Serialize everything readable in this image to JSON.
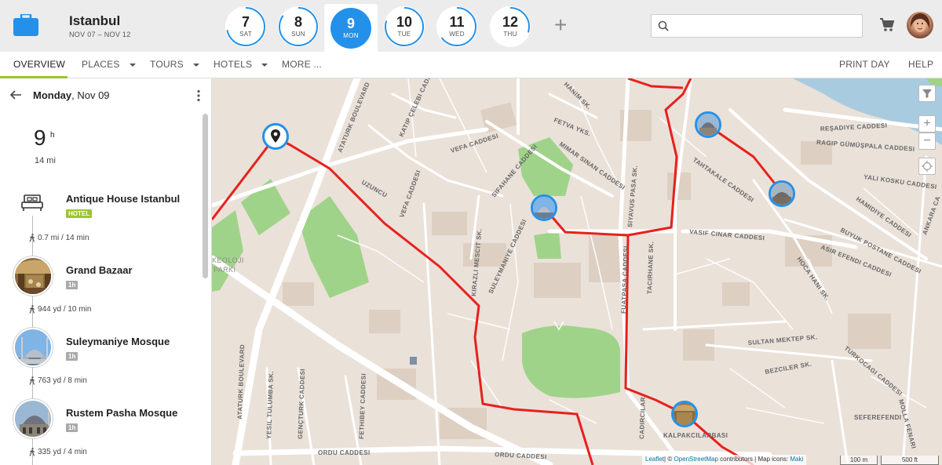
{
  "header": {
    "city": "Istanbul",
    "date_range": "NOV 07 – NOV 12",
    "days": [
      {
        "num": "7",
        "name": "SAT",
        "progress": 0.72
      },
      {
        "num": "8",
        "name": "SUN",
        "progress": 0.85
      },
      {
        "num": "9",
        "name": "MON",
        "progress": 1.0,
        "active": true
      },
      {
        "num": "10",
        "name": "TUE",
        "progress": 0.8
      },
      {
        "num": "11",
        "name": "WED",
        "progress": 0.65
      },
      {
        "num": "12",
        "name": "THU",
        "progress": 0.3
      }
    ],
    "add_day": "+",
    "search_placeholder": "",
    "accent": "#2391ea"
  },
  "tabs": {
    "overview": "OVERVIEW",
    "places": "PLACES",
    "tours": "TOURS",
    "hotels": "HOTELS",
    "more": "MORE",
    "more_dots": "...",
    "print_day": "PRINT DAY",
    "help": "HELP",
    "active_color": "#9bc531"
  },
  "sidebar": {
    "weekday": "Monday",
    "date": ", Nov 09",
    "hours_value": "9",
    "hours_unit": "h",
    "distance": "14 mi",
    "stops": [
      {
        "name": "Antique House Istanbul",
        "badge": "HOTEL",
        "badge_color": "#9bc531",
        "icon": "bed-icon"
      },
      {
        "name": "Grand Bazaar",
        "badge": "1h",
        "badge_color": "#aaaaaa"
      },
      {
        "name": "Suleymaniye Mosque",
        "badge": "1h",
        "badge_color": "#aaaaaa"
      },
      {
        "name": "Rustem Pasha Mosque",
        "badge": "1h",
        "badge_color": "#aaaaaa"
      }
    ],
    "legs": [
      {
        "dist": "0.7 mi",
        "time": "14 min"
      },
      {
        "dist": "944 yd",
        "time": "10 min"
      },
      {
        "dist": "763 yd",
        "time": "8 min"
      },
      {
        "dist": "335 yd",
        "time": "4 min"
      }
    ],
    "leg_separator": "/"
  },
  "map": {
    "route_color": "#e8201c",
    "streets": {
      "ataturk_blvd_top": "ATATURK BOULEVARD",
      "ataturk_blvd_bottom": "ATATURK BOULEVARD",
      "katip_celebi": "KATIP ÇELEBI CADDESI",
      "vefa": "VEFA CADDESI",
      "fetva": "FETVA YKS.",
      "mimar_sinan": "MIMAR SINAN CADDESI",
      "sifahane": "SIFAHANE CADDESI",
      "uzuncu": "UZUNCU",
      "vefa2": "VEFA CADDESI",
      "kirazli": "KIRAZLI MESCIT SK.",
      "suleymaniye": "SULEYMANIYE CADDESI",
      "fuatpasa": "FUATPASA CADDESI",
      "siyavus": "SIYAVUS PASA SK.",
      "tacirhane": "TACIRHANE SK.",
      "vasif": "VASIF CINAR CADDESI",
      "tahtakale": "TAHTAKALE CADDESI",
      "resadiye": "REŞADIYE CADDESI",
      "ragip": "RAGIP GÜMÜŞPALA CADDESI",
      "yali": "YALI KOSKU CADDESI",
      "hamidiye": "HAMIDIYE CADDESI",
      "buyuk_postane": "BUYUK POSTANE CADDESI",
      "asir": "ASIR EFENDI CADDESI",
      "hoca": "HOCA HANI SK.",
      "ankara": "ANKARA CA",
      "sultan_mektep": "SULTAN MEKTEP SK.",
      "bezciler": "BEZCILER SK.",
      "turkocagi": "TURKOCAGI CADDESI",
      "sefer": "SEFEREFENDI",
      "molla": "MOLLA FENARI",
      "cadircilar": "CADIRCILAR",
      "kalpakcilar": "KALPAKCILARBASI",
      "genc_turk": "GENÇTURK CADDESI",
      "fethibey": "FETHIBEY CADDESI",
      "yesil": "YESIL TULUMBA SK.",
      "ordu": "ORDU CADDESI",
      "ordu2": "ORDU CADDESI",
      "arkeoloji1": "KEOLOJI",
      "arkeoloji2": "PARKI",
      "hanim": "HANIM SK.",
      "tahtakale2": "TAHTAKALE CADDESI"
    },
    "attribution": {
      "leaflet": "Leaflet",
      "osm_prefix": "| © ",
      "osm": "OpenStreetMap",
      "rest": " contributors | Map icons: ",
      "maki": "Maki"
    },
    "scale_m": "100 m",
    "scale_ft": "500 ft",
    "zoom_in": "+",
    "zoom_out": "−"
  }
}
